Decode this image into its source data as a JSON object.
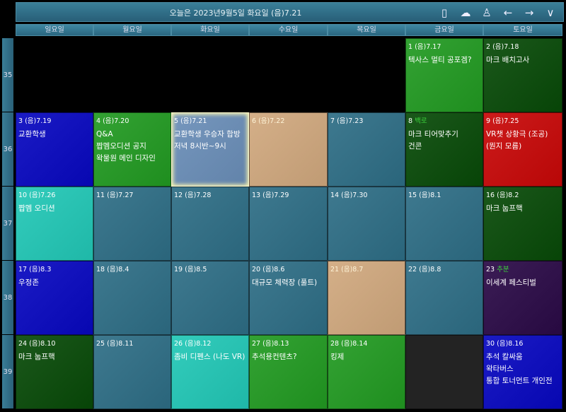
{
  "header": {
    "title": "오늘은 2023년9월5일 화요일 (음)7.21",
    "icons": [
      "phone-icon",
      "cloud-check-icon",
      "user-icon",
      "arrow-left-icon",
      "arrow-right-icon",
      "chevron-down-icon"
    ]
  },
  "weekdays": [
    "일요일",
    "월요일",
    "화요일",
    "수요일",
    "목요일",
    "금요일",
    "토요일"
  ],
  "colors": {
    "teal": "#2e6e86",
    "blue": "#0808c0",
    "green": "#229a22",
    "darkgreen": "#084a08",
    "tan": "#d0a87e",
    "red": "#c80808",
    "cyan": "#22c8b6",
    "purple": "#2a0a46",
    "dark": "#232323",
    "black": "#000000",
    "selected": "#6a8eb8"
  },
  "weeks": [
    {
      "num": "35",
      "days": [
        {
          "color": "black"
        },
        {
          "color": "black"
        },
        {
          "color": "black"
        },
        {
          "color": "black"
        },
        {
          "color": "black"
        },
        {
          "day": "1",
          "lunar": "(음)7.17",
          "color": "green",
          "events": [
            "텍사스 멀티 공포겜?"
          ]
        },
        {
          "day": "2",
          "lunar": "(음)7.18",
          "color": "darkgreen",
          "events": [
            "마크 배치고사"
          ]
        }
      ]
    },
    {
      "num": "36",
      "days": [
        {
          "day": "3",
          "lunar": "(음)7.19",
          "color": "blue",
          "events": [
            "교환학생"
          ]
        },
        {
          "day": "4",
          "lunar": "(음)7.20",
          "color": "green",
          "events": [
            "Q&A",
            "짭멤오디션 공지",
            "왁물원 메인 디자인"
          ]
        },
        {
          "day": "5",
          "lunar": "(음)7.21",
          "color": "selected",
          "selected": true,
          "events": [
            "교환학생 우승자 합방",
            "저녁 8시반~9시"
          ]
        },
        {
          "day": "6",
          "lunar": "(음)7.22",
          "color": "tan",
          "events": []
        },
        {
          "day": "7",
          "lunar": "(음)7.23",
          "color": "teal",
          "events": []
        },
        {
          "day": "8",
          "lunar": "백로",
          "lunarColor": "#3cd23c",
          "color": "darkgreen",
          "events": [
            "마크 티어맞추기",
            "건콘"
          ]
        },
        {
          "day": "9",
          "lunar": "(음)7.25",
          "color": "red",
          "events": [
            "VR챗 상황극 (조공)",
            "(뭔지 모름)"
          ]
        }
      ]
    },
    {
      "num": "37",
      "days": [
        {
          "day": "10",
          "lunar": "(음)7.26",
          "color": "cyan",
          "events": [
            "짭멤 오디션"
          ]
        },
        {
          "day": "11",
          "lunar": "(음)7.27",
          "color": "teal",
          "events": []
        },
        {
          "day": "12",
          "lunar": "(음)7.28",
          "color": "teal",
          "events": []
        },
        {
          "day": "13",
          "lunar": "(음)7.29",
          "color": "teal",
          "events": []
        },
        {
          "day": "14",
          "lunar": "(음)7.30",
          "color": "teal",
          "events": []
        },
        {
          "day": "15",
          "lunar": "(음)8.1",
          "color": "teal",
          "events": []
        },
        {
          "day": "16",
          "lunar": "(음)8.2",
          "color": "darkgreen",
          "events": [
            "마크 눕프핵"
          ]
        }
      ]
    },
    {
      "num": "38",
      "days": [
        {
          "day": "17",
          "lunar": "(음)8.3",
          "color": "blue",
          "events": [
            "우정존"
          ]
        },
        {
          "day": "18",
          "lunar": "(음)8.4",
          "color": "teal",
          "events": []
        },
        {
          "day": "19",
          "lunar": "(음)8.5",
          "color": "teal",
          "events": []
        },
        {
          "day": "20",
          "lunar": "(음)8.6",
          "color": "teal",
          "events": [
            "대규모 체력장 (풀트)"
          ]
        },
        {
          "day": "21",
          "lunar": "(음)8.7",
          "color": "tan",
          "events": []
        },
        {
          "day": "22",
          "lunar": "(음)8.8",
          "color": "teal",
          "events": []
        },
        {
          "day": "23",
          "lunar": "추분",
          "lunarColor": "#3cd23c",
          "color": "purple",
          "events": [
            "이세계 페스티벌"
          ]
        }
      ]
    },
    {
      "num": "39",
      "days": [
        {
          "day": "24",
          "lunar": "(음)8.10",
          "color": "darkgreen",
          "events": [
            "마크 눕프핵"
          ]
        },
        {
          "day": "25",
          "lunar": "(음)8.11",
          "color": "teal",
          "events": []
        },
        {
          "day": "26",
          "lunar": "(음)8.12",
          "color": "cyan",
          "events": [
            "좀비 디펜스 (나도 VR)"
          ]
        },
        {
          "day": "27",
          "lunar": "(음)8.13",
          "color": "green",
          "events": [
            "추석용컨텐츠?"
          ]
        },
        {
          "day": "28",
          "lunar": "(음)8.14",
          "color": "green",
          "events": [
            "킹제"
          ]
        },
        {
          "color": "dark"
        },
        {
          "day": "30",
          "lunar": "(음)8.16",
          "color": "blue",
          "events": [
            "추석 칼싸움",
            "왁타버스",
            "통합 토너먼트 개인전"
          ]
        }
      ]
    }
  ]
}
